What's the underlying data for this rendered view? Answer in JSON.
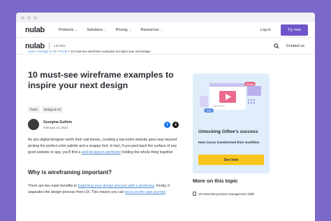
{
  "top_nav": {
    "brand": "nulab",
    "menu": [
      "Products",
      "Solutions",
      "Pricing",
      "Resources"
    ],
    "login": "Log in",
    "try_now": "Try now"
  },
  "sub_nav": {
    "brand": "nulab",
    "section": "LEARN",
    "contact": "Contact us"
  },
  "breadcrumb": {
    "items": [
      "Learn",
      "Design & UX",
      "Posts"
    ],
    "current": "10 must-see wireframe examples to inspire your next design"
  },
  "article": {
    "title": "10 must-see wireframe examples to inspire your next design",
    "tags": [
      "Posts",
      "Design & UX"
    ],
    "author": "Georgina Guthrie",
    "date": "February 16, 2022",
    "intro_before": "As any digital designer worth their salt knows, creating a top-notch website goes way beyond picking the perfect color palette and a snappy font. In fact, if you peel back the surface of any good website or app, you'll find a ",
    "intro_link": "well-designed wireframe",
    "intro_after": " holding the whole thing together.",
    "heading": "Why is wireframing important?",
    "para2_before": "There are two main benefits to ",
    "para2_link1": "beginning your design process with a wireframe",
    "para2_mid": ". Firstly, it separates the design process from UX. This means you can ",
    "para2_link2": "focus on the user journey"
  },
  "promo": {
    "title": "Unlocking Giftee's success",
    "subtitle": "How Cacoo transformed their workflow",
    "button": "See how",
    "badge_left": "Tyler",
    "badge_right": "Thomas"
  },
  "more_topic": {
    "heading": "More on this topic",
    "items": [
      "19 essential product management skills"
    ]
  },
  "colors": {
    "background": "#7b68c8",
    "accent": "#6f55c9",
    "link": "#4a8ad4",
    "promo_bg": "#dfeefa",
    "cta": "#f8c61e"
  }
}
